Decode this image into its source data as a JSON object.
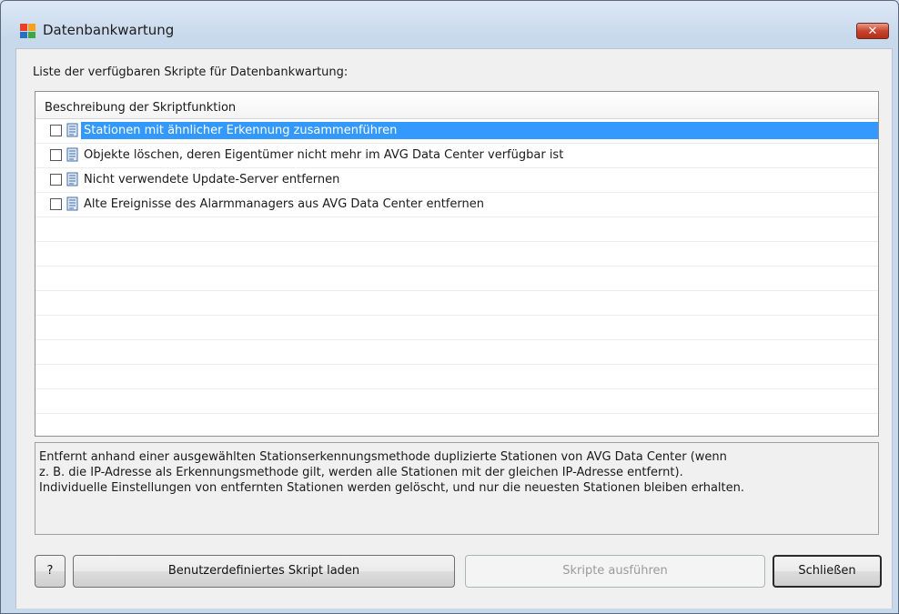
{
  "window": {
    "title": "Datenbankwartung",
    "close_label": "✕"
  },
  "list": {
    "caption": "Liste der verfügbaren Skripte für Datenbankwartung:",
    "column_header": "Beschreibung der Skriptfunktion",
    "items": [
      {
        "label": "Stationen mit ähnlicher Erkennung zusammenführen",
        "checked": false,
        "selected": true
      },
      {
        "label": "Objekte löschen, deren Eigentümer nicht mehr im AVG Data Center verfügbar ist",
        "checked": false,
        "selected": false
      },
      {
        "label": "Nicht verwendete Update-Server entfernen",
        "checked": false,
        "selected": false
      },
      {
        "label": "Alte Ereignisse des Alarmmanagers aus AVG Data Center entfernen",
        "checked": false,
        "selected": false
      }
    ]
  },
  "description": {
    "lines": [
      "Entfernt anhand einer ausgewählten Stationserkennungsmethode duplizierte Stationen von AVG Data Center (wenn",
      "z. B. die IP-Adresse als Erkennungsmethode gilt, werden alle Stationen mit der gleichen IP-Adresse entfernt).",
      "Individuelle Einstellungen von entfernten Stationen werden gelöscht, und nur die neuesten Stationen bleiben erhalten."
    ]
  },
  "buttons": {
    "help": "?",
    "load_script": "Benutzerdefiniertes Skript laden",
    "run_scripts": "Skripte ausführen",
    "close": "Schließen"
  },
  "colors": {
    "selection": "#3399ff",
    "close_button": "#c9432c"
  },
  "icons": {
    "app": "avg-logo-icon",
    "script": "script-scroll-icon",
    "close": "close-icon"
  }
}
